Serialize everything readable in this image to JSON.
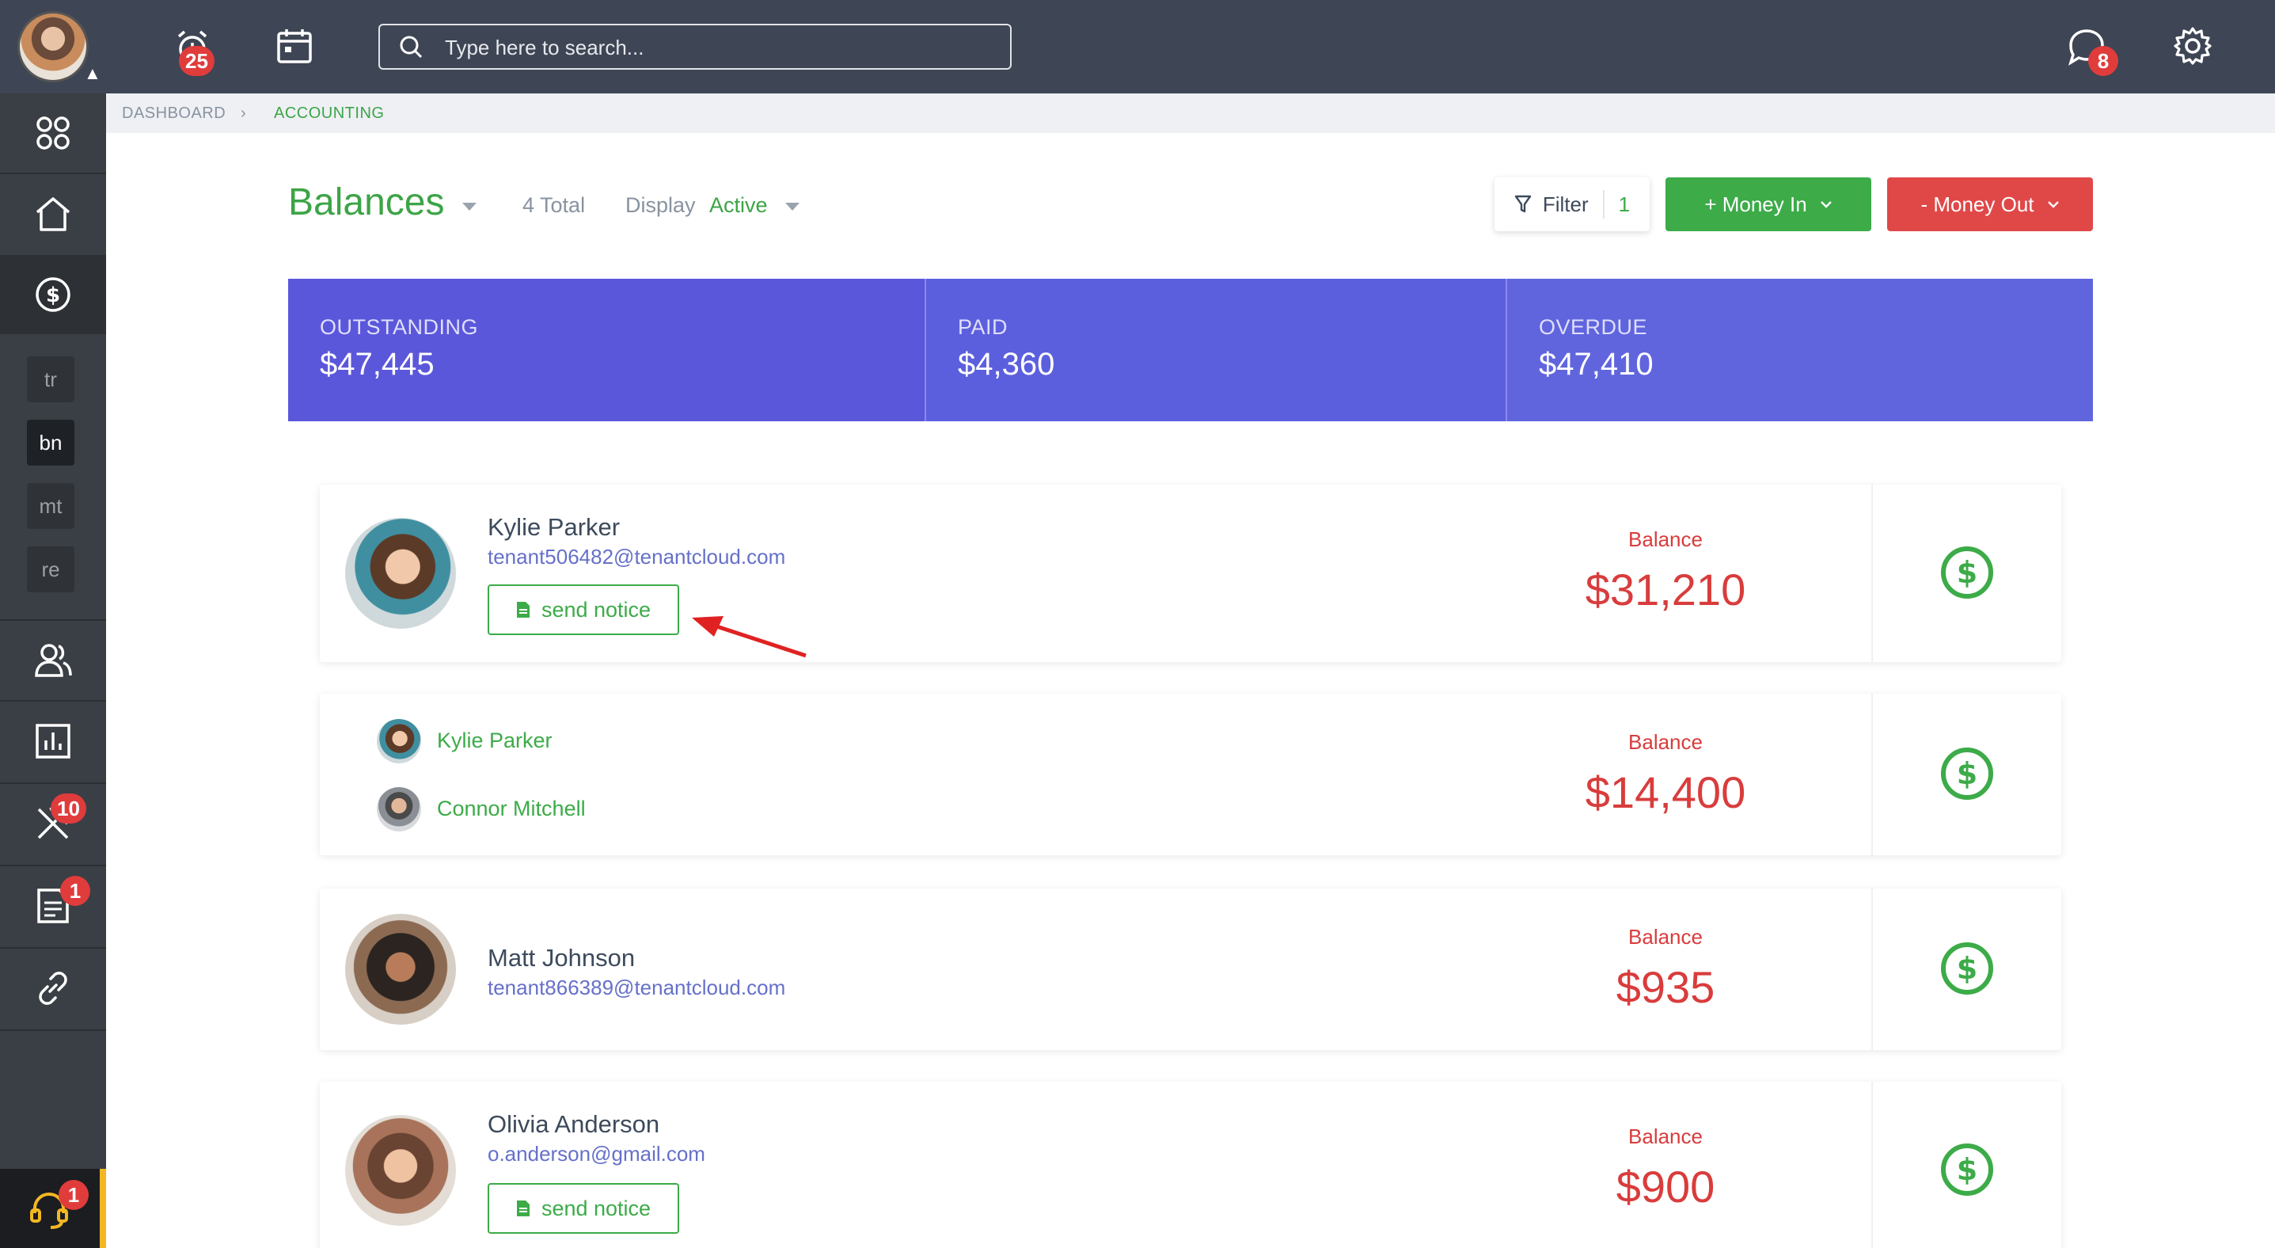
{
  "topbar": {
    "search_placeholder": "Type here to search...",
    "alarm_badge": "25",
    "chat_badge": "8"
  },
  "sidebar": {
    "small_items": [
      "tr",
      "bn",
      "mt",
      "re"
    ],
    "maintenance_badge": "10",
    "documents_badge": "1",
    "help_badge": "1"
  },
  "breadcrumb": {
    "items": [
      "DASHBOARD",
      "ACCOUNTING"
    ]
  },
  "header": {
    "title": "Balances",
    "total": "4 Total",
    "display_label": "Display",
    "display_value": "Active"
  },
  "toolbar": {
    "filter_label": "Filter",
    "filter_count": "1",
    "money_in_label": "+ Money In",
    "money_out_label": "- Money Out"
  },
  "stats": [
    {
      "label": "OUTSTANDING",
      "value": "$47,445"
    },
    {
      "label": "PAID",
      "value": "$4,360"
    },
    {
      "label": "OVERDUE",
      "value": "$47,410"
    }
  ],
  "balances": [
    {
      "name": "Kylie Parker",
      "email": "tenant506482@tenantcloud.com",
      "notice": "send notice",
      "balance_label": "Balance",
      "balance": "$31,210"
    },
    {
      "names": [
        "Kylie Parker",
        "Connor Mitchell"
      ],
      "balance_label": "Balance",
      "balance": "$14,400"
    },
    {
      "name": "Matt Johnson",
      "email": "tenant866389@tenantcloud.com",
      "balance_label": "Balance",
      "balance": "$935"
    },
    {
      "name": "Olivia Anderson",
      "email": "o.anderson@gmail.com",
      "notice": "send notice",
      "balance_label": "Balance",
      "balance": "$900"
    }
  ],
  "colors": {
    "accent_green": "#3cab48",
    "danger_red": "#e04848",
    "stats_purple": "#5a58db",
    "topbar": "#3e4554"
  }
}
